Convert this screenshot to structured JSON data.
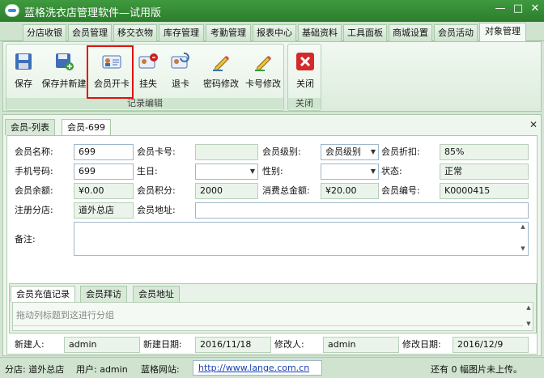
{
  "window": {
    "title": "蓝格洗衣店管理软件—试用版",
    "minimize": "—",
    "maximize": "□",
    "close": "✕"
  },
  "menu_tabs": [
    "分店收银",
    "会员管理",
    "移交衣物",
    "库存管理",
    "考勤管理",
    "报表中心",
    "基础资料",
    "工具面板",
    "商城设置",
    "会员活动",
    "对象管理"
  ],
  "active_menu_tab": "对象管理",
  "ribbon": {
    "group_edit_label": "记录编辑",
    "group_close_label": "关闭",
    "buttons": {
      "save": "保存",
      "save_new": "保存并新建",
      "open_card": "会员开卡",
      "report_loss": "挂失",
      "refund_card": "退卡",
      "change_password": "密码修改",
      "change_card_no": "卡号修改",
      "close": "关闭"
    }
  },
  "doc_tabs": [
    "会员-列表",
    "会员-699"
  ],
  "doc_close": "✕",
  "form": {
    "member_name_label": "会员名称:",
    "member_name": "699",
    "card_no_label": "会员卡号:",
    "card_no": "",
    "level_label": "会员级别:",
    "level": "会员级别",
    "discount_label": "会员折扣:",
    "discount": "85%",
    "phone_label": "手机号码:",
    "phone": "699",
    "birthday_label": "生日:",
    "birthday": "",
    "gender_label": "性别:",
    "gender": "",
    "status_label": "状态:",
    "status": "正常",
    "balance_label": "会员余额:",
    "balance": "¥0.00",
    "points_label": "会员积分:",
    "points": "2000",
    "total_spent_label": "消费总金额:",
    "total_spent": "¥20.00",
    "member_no_label": "会员编号:",
    "member_no": "K0000415",
    "branch_label": "注册分店:",
    "branch": "道外总店",
    "address_label": "会员地址:",
    "address": "",
    "remark_label": "备注:",
    "remark": ""
  },
  "sub_tabs": [
    "会员充值记录",
    "会员拜访",
    "会员地址"
  ],
  "grid_hint": "拖动列标题到这进行分组",
  "footer": {
    "creator_label": "新建人:",
    "creator": "admin",
    "created_label": "新建日期:",
    "created": "2016/11/18",
    "modifier_label": "修改人:",
    "modifier": "admin",
    "modified_label": "修改日期:",
    "modified": "2016/12/9"
  },
  "statusbar": {
    "branch": "分店: 道外总店",
    "user": "用户: admin",
    "site_label": "蓝格网站:",
    "url": "http://www.lange.com.cn",
    "upload": "还有 0 幅图片未上传。"
  },
  "colors": {
    "title_bg": "#2f8a2f",
    "highlight": "#e01010",
    "link": "#1a3fb0"
  }
}
